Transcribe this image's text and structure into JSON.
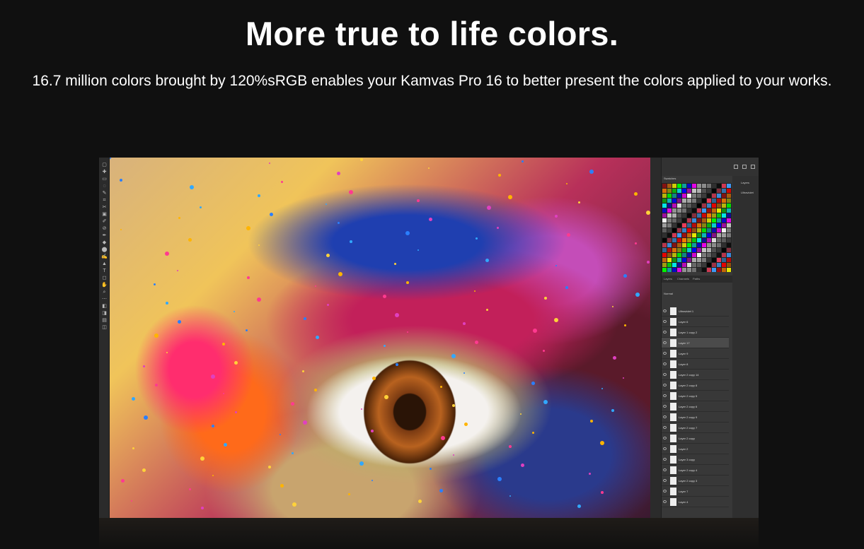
{
  "hero": {
    "title": "More true to life colors.",
    "subtitle": "16.7 million colors brought by 120%sRGB enables your Kamvas Pro 16 to better present the colors applied to your works."
  },
  "editor": {
    "swatches_panel_title": "Swatches",
    "side_panel": {
      "top_label": "Layers",
      "item_label": "Ultraviolet"
    },
    "tabs": [
      "Layers",
      "Channels",
      "Paths"
    ],
    "layer_blend_mode": "Normal",
    "layers": [
      {
        "name": "Ultraviolet 1",
        "selected": false
      },
      {
        "name": "Layer 6",
        "selected": false
      },
      {
        "name": "Layer 1 copy 2",
        "selected": false
      },
      {
        "name": "Layer 17",
        "selected": true
      },
      {
        "name": "Layer 9",
        "selected": false
      },
      {
        "name": "Layer 8",
        "selected": false
      },
      {
        "name": "Layer 2 copy 14",
        "selected": false
      },
      {
        "name": "Layer 2 copy 8",
        "selected": false
      },
      {
        "name": "Layer 2 copy 5",
        "selected": false
      },
      {
        "name": "Layer 2 copy 6",
        "selected": false
      },
      {
        "name": "Layer 2 copy 9",
        "selected": false
      },
      {
        "name": "Layer 2 copy 7",
        "selected": false
      },
      {
        "name": "Layer 2 copy",
        "selected": false
      },
      {
        "name": "Layer 2",
        "selected": false
      },
      {
        "name": "Layer 3 copy",
        "selected": false
      },
      {
        "name": "Layer 2 copy 4",
        "selected": false
      },
      {
        "name": "Layer 2 copy 3",
        "selected": false
      },
      {
        "name": "Layer 7",
        "selected": false
      },
      {
        "name": "Layer 4",
        "selected": false
      }
    ],
    "swatch_colors": [
      "#ff0000",
      "#ff8000",
      "#ffff00",
      "#00ff00",
      "#00ffff",
      "#0000ff",
      "#ff00ff",
      "#ffffff",
      "#c0c0c0",
      "#808080",
      "#404040",
      "#000000",
      "#ff4060",
      "#40a0ff"
    ]
  },
  "colors": {
    "page_bg": "#101010",
    "text": "#ffffff",
    "panel_bg": "#383838"
  }
}
